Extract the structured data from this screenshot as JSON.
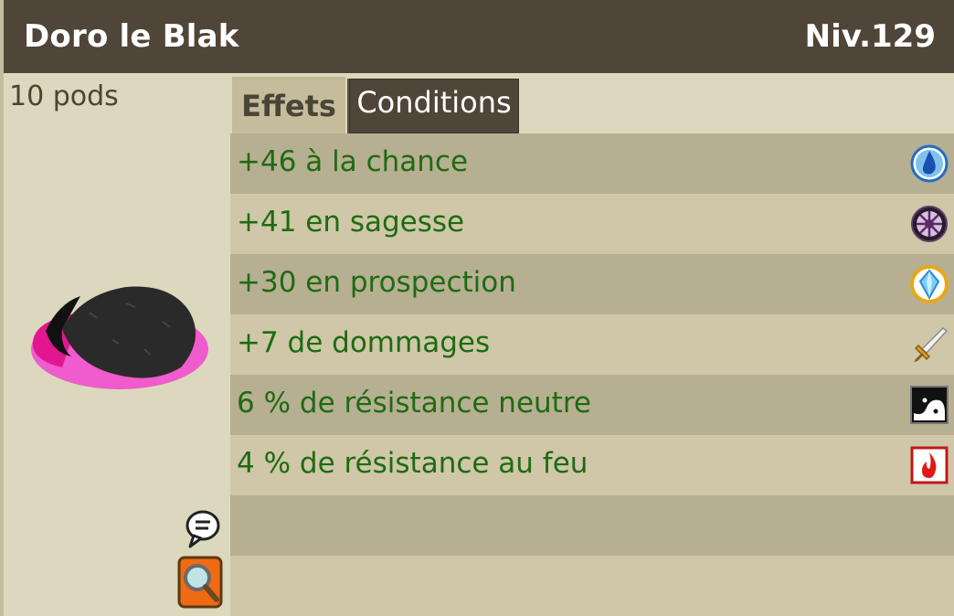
{
  "header": {
    "name": "Doro le Blak",
    "level": "Niv.129"
  },
  "item": {
    "weight": "10 pods",
    "image_icon": "hat-icon"
  },
  "tabs": [
    {
      "label": "Effets",
      "active": true
    },
    {
      "label": "Conditions",
      "active": false
    }
  ],
  "effects": [
    {
      "text": "+46 à la chance",
      "icon": "water-drop-icon"
    },
    {
      "text": "+41 en sagesse",
      "icon": "wisdom-wheel-icon"
    },
    {
      "text": "+30 en prospection",
      "icon": "prospection-crystal-icon"
    },
    {
      "text": "+7 de dommages",
      "icon": "sword-icon"
    },
    {
      "text": "6 % de résistance neutre",
      "icon": "neutral-yin-yang-icon"
    },
    {
      "text": "4 % de résistance au feu",
      "icon": "fire-icon"
    }
  ],
  "colors": {
    "header_bg": "#4f4538",
    "panel_bg": "#d9d4b6",
    "effect_text": "#1e6b12",
    "row_dark": "#b7af91",
    "row_light": "#cfc7a8"
  }
}
